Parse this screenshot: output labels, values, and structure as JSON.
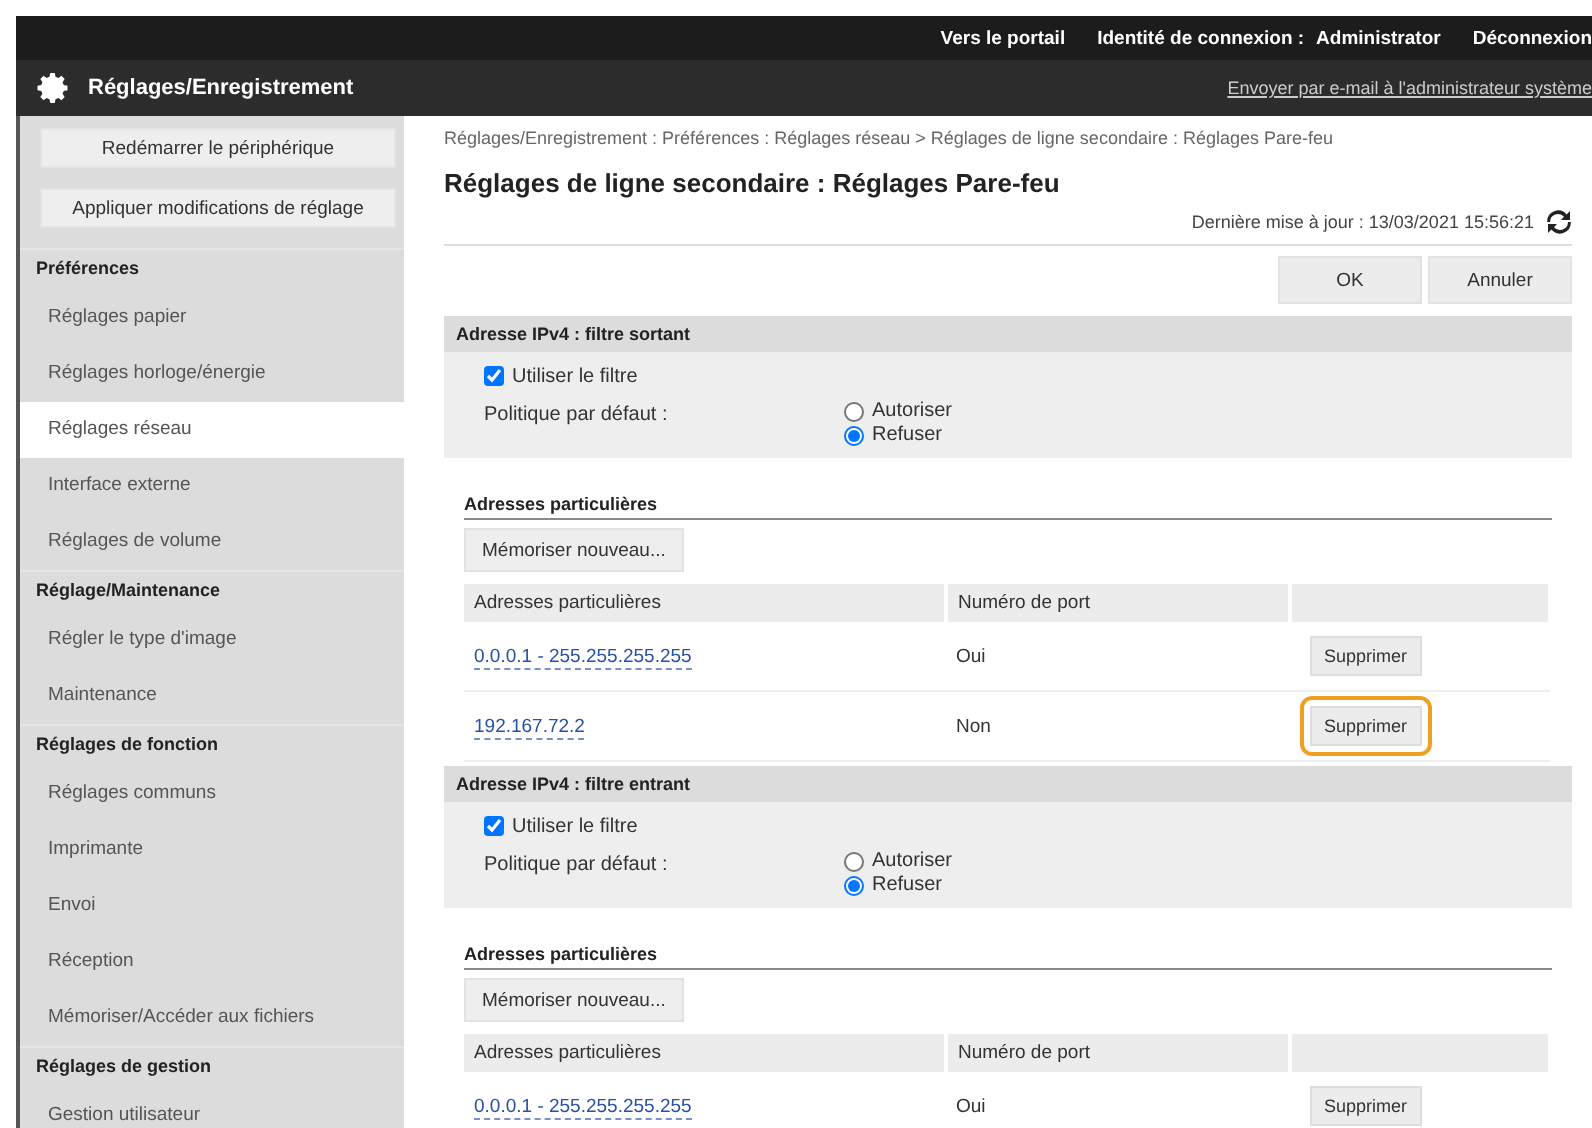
{
  "header": {
    "portal_link": "Vers le portail",
    "login_label": "Identité de connexion :",
    "login_user": "Administrator",
    "logout_link": "Déconnexion",
    "title": "Réglages/Enregistrement",
    "email_link": "Envoyer par e-mail à l'administrateur système"
  },
  "sidebar": {
    "buttons": [
      "Redémarrer le périphérique",
      "Appliquer modifications de réglage"
    ],
    "groups": [
      {
        "title": "Préférences",
        "items": [
          {
            "label": "Réglages papier",
            "selected": false
          },
          {
            "label": "Réglages horloge/énergie",
            "selected": false
          },
          {
            "label": "Réglages réseau",
            "selected": true
          },
          {
            "label": "Interface externe",
            "selected": false
          },
          {
            "label": "Réglages de volume",
            "selected": false
          }
        ]
      },
      {
        "title": "Réglage/Maintenance",
        "items": [
          {
            "label": "Régler le type d'image",
            "selected": false
          },
          {
            "label": "Maintenance",
            "selected": false
          }
        ]
      },
      {
        "title": "Réglages de fonction",
        "items": [
          {
            "label": "Réglages communs",
            "selected": false
          },
          {
            "label": "Imprimante",
            "selected": false
          },
          {
            "label": "Envoi",
            "selected": false
          },
          {
            "label": "Réception",
            "selected": false
          },
          {
            "label": "Mémoriser/Accéder aux fichiers",
            "selected": false
          }
        ]
      },
      {
        "title": "Réglages de gestion",
        "items": [
          {
            "label": "Gestion utilisateur",
            "selected": false
          }
        ]
      }
    ]
  },
  "breadcrumb": "Réglages/Enregistrement : Préférences : Réglages réseau > Réglages de ligne secondaire : Réglages Pare-feu",
  "page_title": "Réglages de ligne secondaire : Réglages Pare-feu",
  "last_update": "Dernière mise à jour : 13/03/2021 15:56:21",
  "buttons": [
    "OK",
    "Annuler"
  ],
  "sections": [
    {
      "title": "Adresse IPv4 : filtre sortant",
      "use_filter": {
        "label": "Utiliser le filtre",
        "checked": true
      },
      "policy_label": "Politique par défaut :",
      "policy_options": [
        {
          "label": "Autoriser",
          "selected": false
        },
        {
          "label": "Refuser",
          "selected": true
        }
      ],
      "addresses_title": "Adresses particulières",
      "register_button": "Mémoriser nouveau...",
      "columns": [
        "Adresses particulières",
        "Numéro de port"
      ],
      "rows": [
        {
          "address": "0.0.0.1 - 255.255.255.255",
          "port": "Oui",
          "delete_button": "Supprimer",
          "highlighted": false
        },
        {
          "address": "192.167.72.2",
          "port": "Non",
          "delete_button": "Supprimer",
          "highlighted": true
        }
      ]
    },
    {
      "title": "Adresse IPv4 : filtre entrant",
      "use_filter": {
        "label": "Utiliser le filtre",
        "checked": true
      },
      "policy_label": "Politique par défaut :",
      "policy_options": [
        {
          "label": "Autoriser",
          "selected": false
        },
        {
          "label": "Refuser",
          "selected": true
        }
      ],
      "addresses_title": "Adresses particulières",
      "register_button": "Mémoriser nouveau...",
      "columns": [
        "Adresses particulières",
        "Numéro de port"
      ],
      "rows": [
        {
          "address": "0.0.0.1 - 255.255.255.255",
          "port": "Oui",
          "delete_button": "Supprimer",
          "highlighted": false
        }
      ]
    }
  ]
}
